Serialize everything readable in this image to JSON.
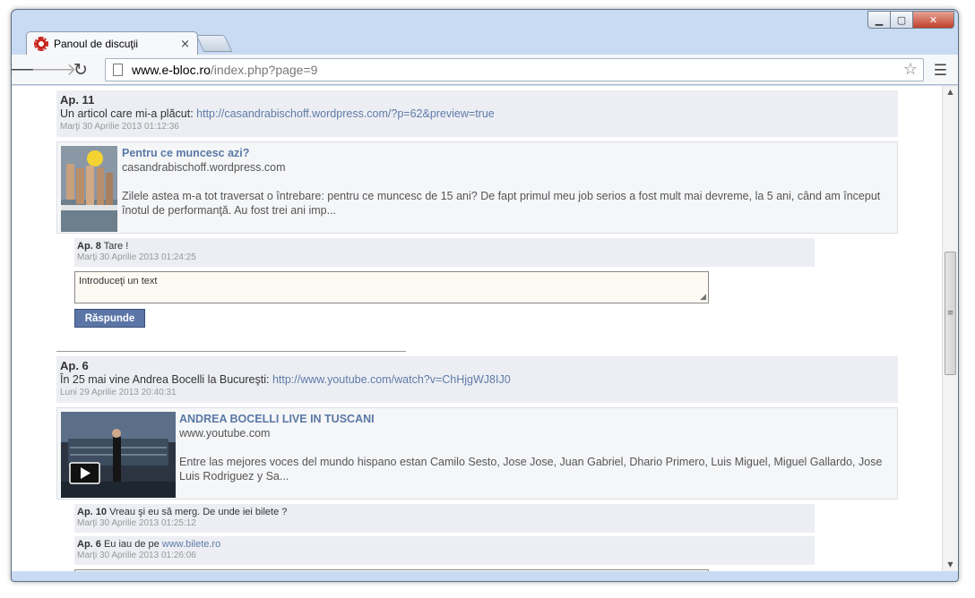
{
  "browser": {
    "tab_title": "Panoul de discuţii",
    "tab_close": "×",
    "url_host": "www.e-bloc.ro",
    "url_path": "/index.php?page=9",
    "back_icon": "arrow-left-icon",
    "forward_icon": "arrow-right-icon",
    "reload_icon": "reload-icon",
    "star_icon": "star-icon",
    "menu_icon": "menu-icon"
  },
  "posts": [
    {
      "author": "Ap. 11",
      "text": "Un articol care mi-a plăcut: ",
      "link": "http://casandrabischoff.wordpress.com/?p=62&preview=true",
      "date": "Marţi 30 Aprilie 2013 01:12:36",
      "preview": {
        "title": "Pentru ce muncesc azi?",
        "domain": "casandrabischoff.wordpress.com",
        "description": "Zilele astea m-a tot traversat o întrebare: pentru ce muncesc de 15 ani? De fapt primul meu job serios a fost mult mai devreme, la 5 ani, când am început înotul de performanţă. Au fost trei ani imp..."
      },
      "replies": [
        {
          "author": "Ap. 8",
          "text": " Tare !",
          "date": "Marţi 30 Aprilie 2013 01:24:25"
        }
      ],
      "reply_placeholder": "Introduceţi un text",
      "reply_button": "Răspunde"
    },
    {
      "author": "Ap. 6",
      "text": "În 25 mai vine Andrea Bocelli la Bucureşti: ",
      "link": "http://www.youtube.com/watch?v=ChHjgWJ8IJ0",
      "date": "Luni 29 Aprilie 2013 20:40:31",
      "preview": {
        "title": "ANDREA BOCELLI LIVE IN TUSCANI",
        "domain": "www.youtube.com",
        "description": "Entre las mejores voces del mundo hispano estan Camilo Sesto, Jose Jose, Juan Gabriel, Dhario Primero, Luis Miguel, Miguel Gallardo, Jose Luis Rodriguez y Sa..."
      },
      "replies": [
        {
          "author": "Ap. 10",
          "text": " Vreau şi eu să merg. De unde iei bilete ?",
          "date": "Marţi 30 Aprilie 2013 01:25:12"
        },
        {
          "author": "Ap. 6",
          "text": " Eu iau de pe ",
          "link": "www.bilete.ro",
          "date": "Marţi 30 Aprilie 2013 01:26:06"
        }
      ]
    }
  ]
}
